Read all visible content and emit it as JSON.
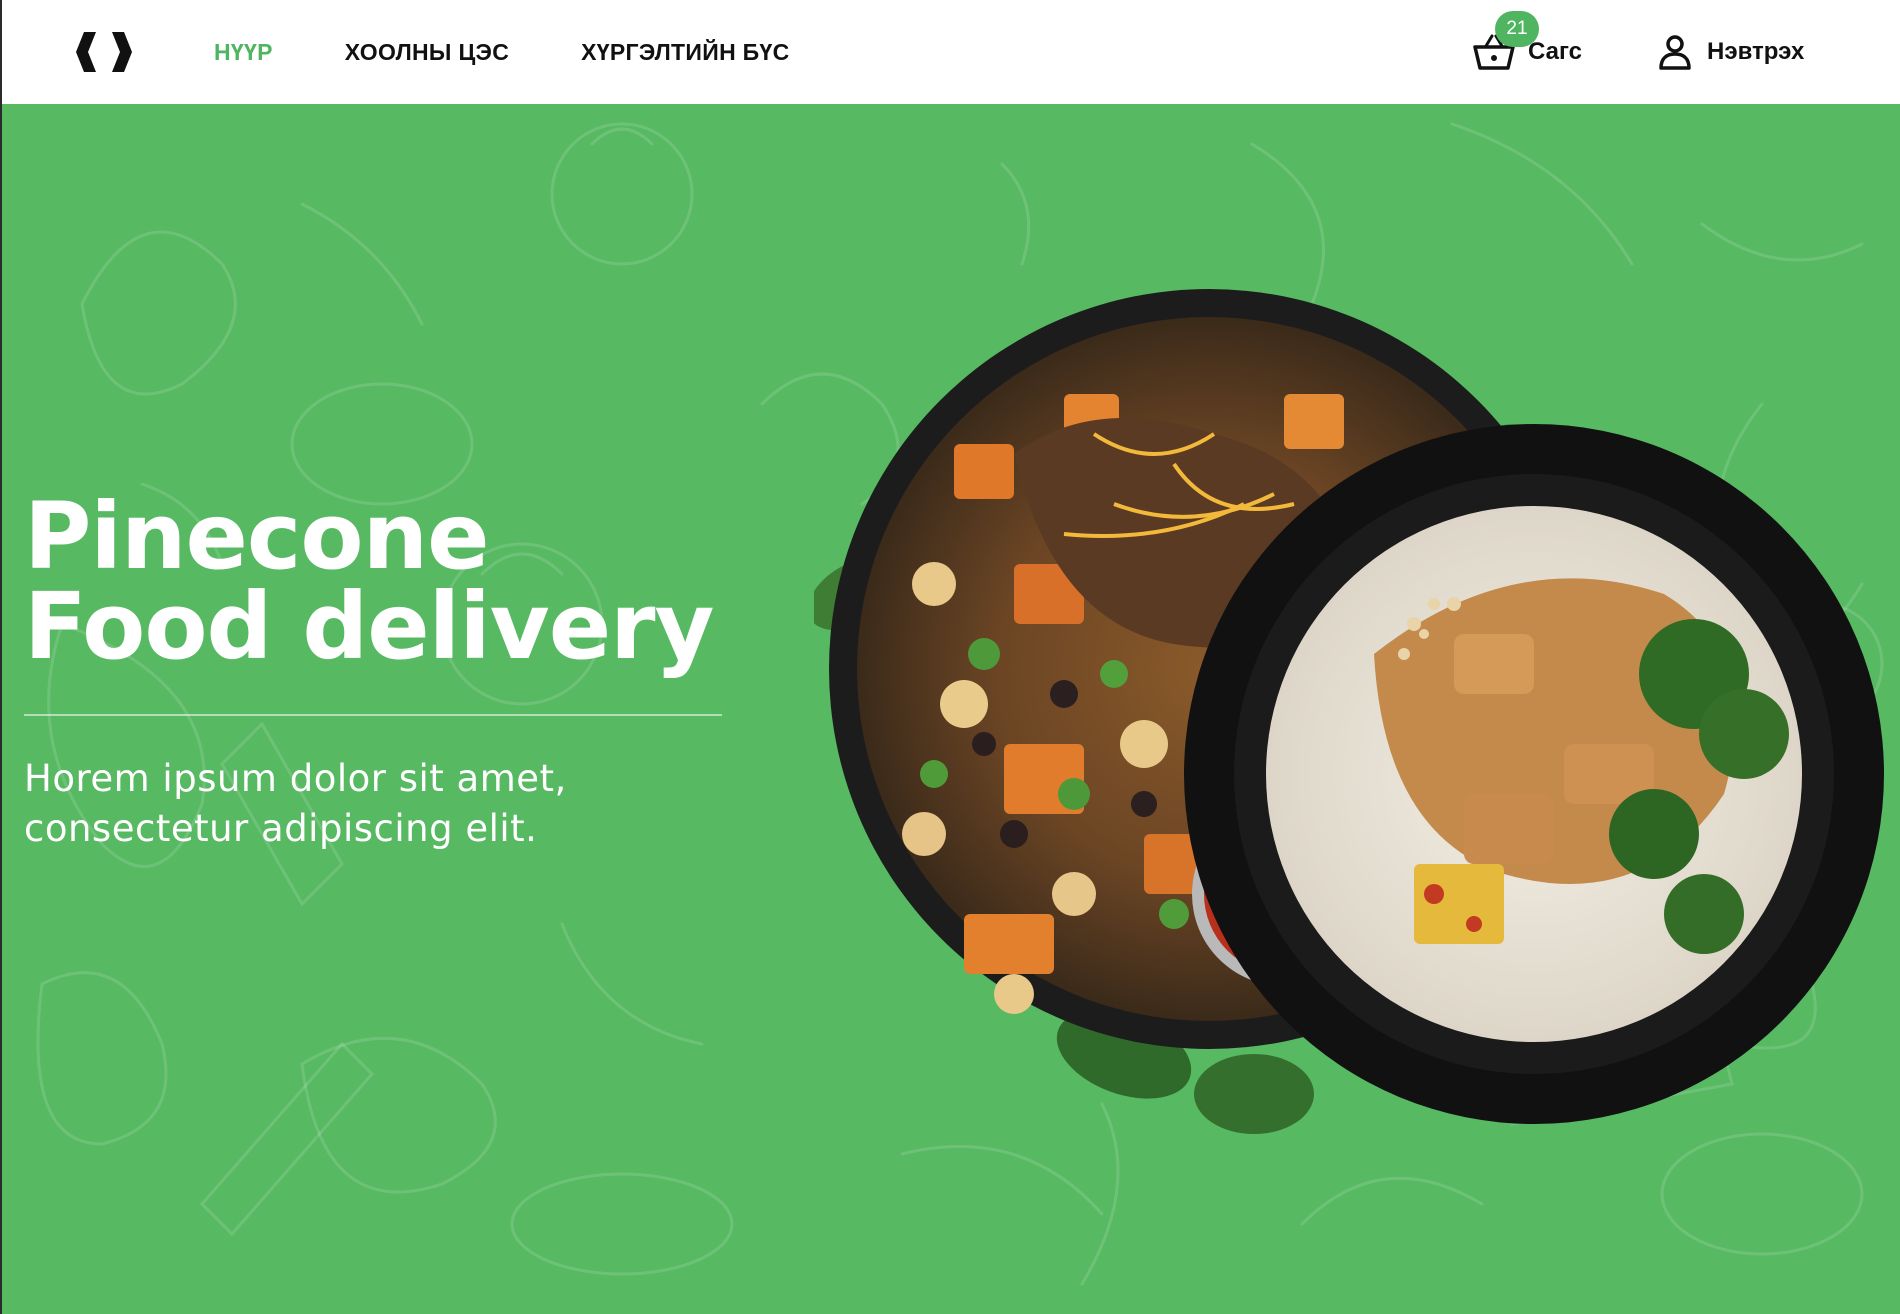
{
  "header": {
    "logo": "logo-brackets-icon",
    "nav": [
      {
        "label": "НҮҮР",
        "active": true
      },
      {
        "label": "ХООЛНЫ ЦЭС",
        "active": false
      },
      {
        "label": "ХҮРГЭЛТИЙН БҮС",
        "active": false
      }
    ],
    "cart": {
      "label": "Сагс",
      "count": "21",
      "icon": "basket-icon"
    },
    "login": {
      "label": "Нэвтрэх",
      "icon": "user-icon"
    }
  },
  "hero": {
    "title_line1": "Pinecone",
    "title_line2": "Food delivery",
    "subtitle_line1": "Horem ipsum dolor sit amet,",
    "subtitle_line2": "consectetur adipiscing elit.",
    "image": "food-bowls-image",
    "background_pattern": "vegetable-doodle-pattern"
  },
  "colors": {
    "accent": "#4fb560",
    "hero_bg": "#57b962",
    "text_dark": "#111111",
    "text_light": "#ffffff"
  }
}
